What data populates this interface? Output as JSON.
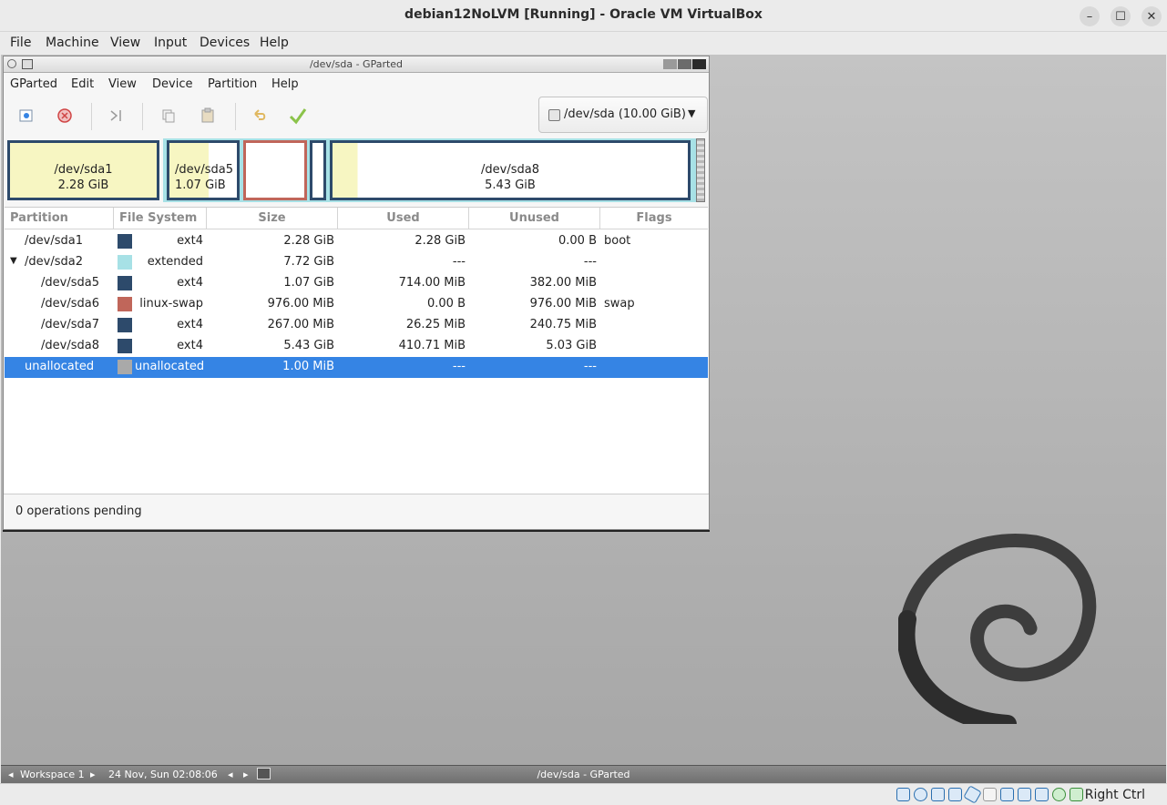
{
  "vbox": {
    "title": "debian12NoLVM [Running] - Oracle VM VirtualBox",
    "menu": [
      "File",
      "Machine",
      "View",
      "Input",
      "Devices",
      "Help"
    ],
    "window_controls": {
      "minimize": "–",
      "maximize": "☐",
      "close": "✕"
    },
    "status_host_key": "Right Ctrl"
  },
  "gparted": {
    "title": "/dev/sda - GParted",
    "menu": [
      "GParted",
      "Edit",
      "View",
      "Device",
      "Partition",
      "Help"
    ],
    "device_selector": "/dev/sda (10.00 GiB)",
    "disk_map": {
      "sda1": {
        "name": "/dev/sda1",
        "size": "2.28 GiB"
      },
      "sda5": {
        "name": "/dev/sda5",
        "size": "1.07 GiB"
      },
      "sda8": {
        "name": "/dev/sda8",
        "size": "5.43 GiB"
      }
    },
    "columns": [
      "Partition",
      "File System",
      "Size",
      "Used",
      "Unused",
      "Flags"
    ],
    "rows": [
      {
        "partition": "/dev/sda1",
        "fs": "ext4",
        "color": "#2d4a6b",
        "size": "2.28 GiB",
        "used": "2.28 GiB",
        "unused": "0.00 B",
        "flags": "boot"
      },
      {
        "partition": "/dev/sda2",
        "fs": "extended",
        "color": "#a7e1e6",
        "size": "7.72 GiB",
        "used": "---",
        "unused": "---",
        "flags": ""
      },
      {
        "partition": "/dev/sda5",
        "fs": "ext4",
        "color": "#2d4a6b",
        "size": "1.07 GiB",
        "used": "714.00 MiB",
        "unused": "382.00 MiB",
        "flags": ""
      },
      {
        "partition": "/dev/sda6",
        "fs": "linux-swap",
        "color": "#c0665a",
        "size": "976.00 MiB",
        "used": "0.00 B",
        "unused": "976.00 MiB",
        "flags": "swap"
      },
      {
        "partition": "/dev/sda7",
        "fs": "ext4",
        "color": "#2d4a6b",
        "size": "267.00 MiB",
        "used": "26.25 MiB",
        "unused": "240.75 MiB",
        "flags": ""
      },
      {
        "partition": "/dev/sda8",
        "fs": "ext4",
        "color": "#2d4a6b",
        "size": "5.43 GiB",
        "used": "410.71 MiB",
        "unused": "5.03 GiB",
        "flags": ""
      },
      {
        "partition": "unallocated",
        "fs": "unallocated",
        "color": "#a9a9a9",
        "size": "1.00 MiB",
        "used": "---",
        "unused": "---",
        "flags": ""
      }
    ],
    "status": "0 operations pending"
  },
  "taskbar": {
    "workspace": "Workspace 1",
    "clock": "24 Nov, Sun 02:08:06",
    "window": "/dev/sda - GParted"
  }
}
